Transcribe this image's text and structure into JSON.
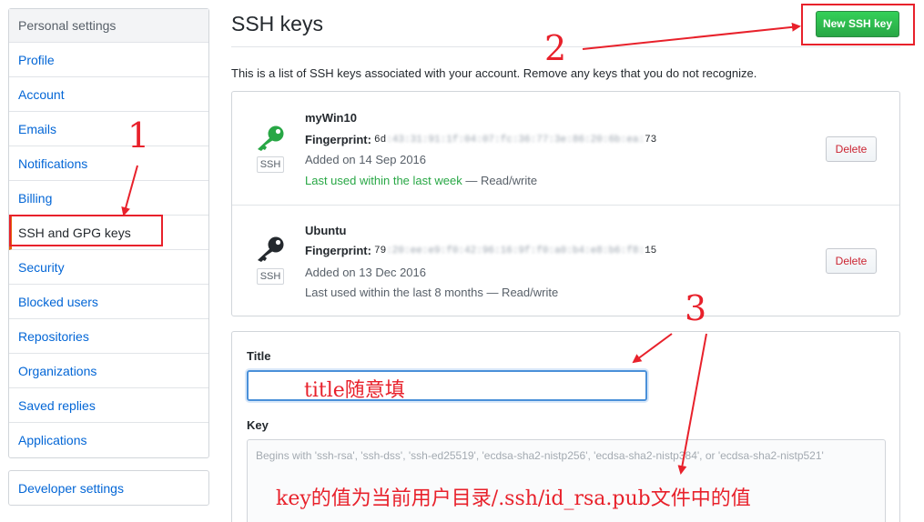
{
  "sidebar": {
    "header": "Personal settings",
    "items": [
      {
        "label": "Profile"
      },
      {
        "label": "Account"
      },
      {
        "label": "Emails"
      },
      {
        "label": "Notifications"
      },
      {
        "label": "Billing"
      },
      {
        "label": "SSH and GPG keys",
        "selected": true
      },
      {
        "label": "Security"
      },
      {
        "label": "Blocked users"
      },
      {
        "label": "Repositories"
      },
      {
        "label": "Organizations"
      },
      {
        "label": "Saved replies"
      },
      {
        "label": "Applications"
      }
    ],
    "developer_settings": "Developer settings"
  },
  "header": {
    "title": "SSH keys",
    "new_button": "New SSH key",
    "description": "This is a list of SSH keys associated with your account. Remove any keys that you do not recognize."
  },
  "keys": [
    {
      "name": "myWin10",
      "fingerprint_label": "Fingerprint:",
      "fingerprint_start": "6d",
      "fingerprint_blurred": ":43:31:91:1f:04:07:fc:36:77:3e:86:20:6b:ea:",
      "fingerprint_end": "73",
      "added": "Added on 14 Sep 2016",
      "last_used_recent": "Last used within the last week",
      "last_used_suffix": " — Read/write",
      "badge": "SSH",
      "delete_label": "Delete",
      "icon_color": "#28a745"
    },
    {
      "name": "Ubuntu",
      "fingerprint_label": "Fingerprint:",
      "fingerprint_start": "79",
      "fingerprint_blurred": ":20:ee:e9:f0:42:96:16:9f:f0:a0:b4:e8:b6:f8:",
      "fingerprint_end": "15",
      "added": "Added on 13 Dec 2016",
      "last_used_recent": "",
      "last_used_suffix": "Last used within the last 8 months — Read/write",
      "badge": "SSH",
      "delete_label": "Delete",
      "icon_color": "#24292e"
    }
  ],
  "form": {
    "title_label": "Title",
    "key_label": "Key",
    "key_placeholder": "Begins with 'ssh-rsa', 'ssh-dss', 'ssh-ed25519', 'ecdsa-sha2-nistp256', 'ecdsa-sha2-nistp384', or 'ecdsa-sha2-nistp521'"
  },
  "annotations": {
    "num1": "1",
    "num2": "2",
    "num3": "3",
    "title_note": "title随意填",
    "key_note": "key的值为当前用户目录/.ssh/id_rsa.pub文件中的值",
    "color": "#e8212b"
  }
}
